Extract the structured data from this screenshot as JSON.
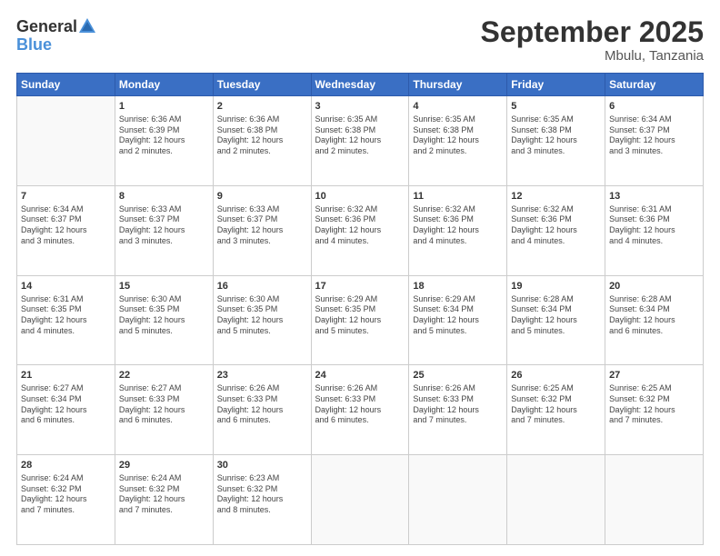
{
  "header": {
    "logo_general": "General",
    "logo_blue": "Blue",
    "title": "September 2025",
    "subtitle": "Mbulu, Tanzania"
  },
  "weekdays": [
    "Sunday",
    "Monday",
    "Tuesday",
    "Wednesday",
    "Thursday",
    "Friday",
    "Saturday"
  ],
  "weeks": [
    [
      {
        "day": "",
        "info": ""
      },
      {
        "day": "1",
        "info": "Sunrise: 6:36 AM\nSunset: 6:39 PM\nDaylight: 12 hours\nand 2 minutes."
      },
      {
        "day": "2",
        "info": "Sunrise: 6:36 AM\nSunset: 6:38 PM\nDaylight: 12 hours\nand 2 minutes."
      },
      {
        "day": "3",
        "info": "Sunrise: 6:35 AM\nSunset: 6:38 PM\nDaylight: 12 hours\nand 2 minutes."
      },
      {
        "day": "4",
        "info": "Sunrise: 6:35 AM\nSunset: 6:38 PM\nDaylight: 12 hours\nand 2 minutes."
      },
      {
        "day": "5",
        "info": "Sunrise: 6:35 AM\nSunset: 6:38 PM\nDaylight: 12 hours\nand 3 minutes."
      },
      {
        "day": "6",
        "info": "Sunrise: 6:34 AM\nSunset: 6:37 PM\nDaylight: 12 hours\nand 3 minutes."
      }
    ],
    [
      {
        "day": "7",
        "info": "Sunrise: 6:34 AM\nSunset: 6:37 PM\nDaylight: 12 hours\nand 3 minutes."
      },
      {
        "day": "8",
        "info": "Sunrise: 6:33 AM\nSunset: 6:37 PM\nDaylight: 12 hours\nand 3 minutes."
      },
      {
        "day": "9",
        "info": "Sunrise: 6:33 AM\nSunset: 6:37 PM\nDaylight: 12 hours\nand 3 minutes."
      },
      {
        "day": "10",
        "info": "Sunrise: 6:32 AM\nSunset: 6:36 PM\nDaylight: 12 hours\nand 4 minutes."
      },
      {
        "day": "11",
        "info": "Sunrise: 6:32 AM\nSunset: 6:36 PM\nDaylight: 12 hours\nand 4 minutes."
      },
      {
        "day": "12",
        "info": "Sunrise: 6:32 AM\nSunset: 6:36 PM\nDaylight: 12 hours\nand 4 minutes."
      },
      {
        "day": "13",
        "info": "Sunrise: 6:31 AM\nSunset: 6:36 PM\nDaylight: 12 hours\nand 4 minutes."
      }
    ],
    [
      {
        "day": "14",
        "info": "Sunrise: 6:31 AM\nSunset: 6:35 PM\nDaylight: 12 hours\nand 4 minutes."
      },
      {
        "day": "15",
        "info": "Sunrise: 6:30 AM\nSunset: 6:35 PM\nDaylight: 12 hours\nand 5 minutes."
      },
      {
        "day": "16",
        "info": "Sunrise: 6:30 AM\nSunset: 6:35 PM\nDaylight: 12 hours\nand 5 minutes."
      },
      {
        "day": "17",
        "info": "Sunrise: 6:29 AM\nSunset: 6:35 PM\nDaylight: 12 hours\nand 5 minutes."
      },
      {
        "day": "18",
        "info": "Sunrise: 6:29 AM\nSunset: 6:34 PM\nDaylight: 12 hours\nand 5 minutes."
      },
      {
        "day": "19",
        "info": "Sunrise: 6:28 AM\nSunset: 6:34 PM\nDaylight: 12 hours\nand 5 minutes."
      },
      {
        "day": "20",
        "info": "Sunrise: 6:28 AM\nSunset: 6:34 PM\nDaylight: 12 hours\nand 6 minutes."
      }
    ],
    [
      {
        "day": "21",
        "info": "Sunrise: 6:27 AM\nSunset: 6:34 PM\nDaylight: 12 hours\nand 6 minutes."
      },
      {
        "day": "22",
        "info": "Sunrise: 6:27 AM\nSunset: 6:33 PM\nDaylight: 12 hours\nand 6 minutes."
      },
      {
        "day": "23",
        "info": "Sunrise: 6:26 AM\nSunset: 6:33 PM\nDaylight: 12 hours\nand 6 minutes."
      },
      {
        "day": "24",
        "info": "Sunrise: 6:26 AM\nSunset: 6:33 PM\nDaylight: 12 hours\nand 6 minutes."
      },
      {
        "day": "25",
        "info": "Sunrise: 6:26 AM\nSunset: 6:33 PM\nDaylight: 12 hours\nand 7 minutes."
      },
      {
        "day": "26",
        "info": "Sunrise: 6:25 AM\nSunset: 6:32 PM\nDaylight: 12 hours\nand 7 minutes."
      },
      {
        "day": "27",
        "info": "Sunrise: 6:25 AM\nSunset: 6:32 PM\nDaylight: 12 hours\nand 7 minutes."
      }
    ],
    [
      {
        "day": "28",
        "info": "Sunrise: 6:24 AM\nSunset: 6:32 PM\nDaylight: 12 hours\nand 7 minutes."
      },
      {
        "day": "29",
        "info": "Sunrise: 6:24 AM\nSunset: 6:32 PM\nDaylight: 12 hours\nand 7 minutes."
      },
      {
        "day": "30",
        "info": "Sunrise: 6:23 AM\nSunset: 6:32 PM\nDaylight: 12 hours\nand 8 minutes."
      },
      {
        "day": "",
        "info": ""
      },
      {
        "day": "",
        "info": ""
      },
      {
        "day": "",
        "info": ""
      },
      {
        "day": "",
        "info": ""
      }
    ]
  ]
}
